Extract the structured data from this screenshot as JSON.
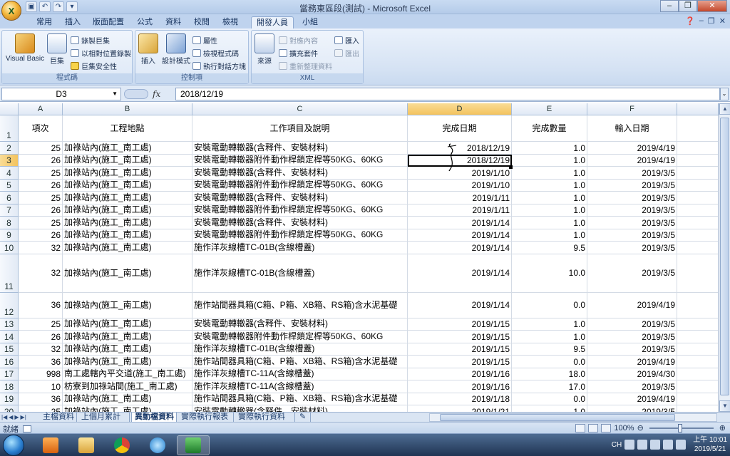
{
  "window": {
    "title": "當務東區段(測試) - Microsoft Excel",
    "minimize_icon": "minimize-icon",
    "maximize_icon": "restore-icon",
    "close_icon": "close-icon"
  },
  "ribbon": {
    "tabs": [
      "常用",
      "插入",
      "版面配置",
      "公式",
      "資料",
      "校閱",
      "檢視",
      "開發人員",
      "小組"
    ],
    "active_tab": "開發人員",
    "groups": {
      "code": {
        "label": "程式碼",
        "visual_basic": "Visual Basic",
        "macros": "巨集",
        "record_macro": "錄製巨集",
        "relative_ref": "以相對位置錄製",
        "macro_security": "巨集安全性"
      },
      "controls": {
        "label": "控制項",
        "insert": "插入",
        "design_mode": "設計模式",
        "properties": "屬性",
        "view_code": "檢視程式碼",
        "run_dialog": "執行對話方塊"
      },
      "xml": {
        "label": "XML",
        "source": "來源",
        "map_properties": "對應內容",
        "expansion_packs": "擴充套件",
        "refresh_data": "重新整理資料",
        "import": "匯入",
        "export": "匯出"
      }
    }
  },
  "formula_bar": {
    "name_box": "D3",
    "fx": "fx",
    "content": "2018/12/19"
  },
  "sheet": {
    "columns": [
      "A",
      "B",
      "C",
      "D",
      "E",
      "F"
    ],
    "selected_column": "D",
    "header_row": {
      "row_num": "1",
      "cells": [
        "項次",
        "工程地點",
        "工作項目及說明",
        "完成日期",
        "完成數量",
        "輸入日期"
      ]
    },
    "rows": [
      {
        "n": "2",
        "a": "25",
        "b": "加祿站內(施工_南工處)",
        "c": "安裝電動轉轍器(含释件、安裝材料)",
        "d": "2018/12/19",
        "e": "1.0",
        "f": "2019/4/19"
      },
      {
        "n": "3",
        "a": "26",
        "b": "加祿站內(施工_南工處)",
        "c": "安裝電動轉轍器附件動作桿鎖定桿等50KG、60KG",
        "d": "2018/12/19",
        "e": "1.0",
        "f": "2019/4/19"
      },
      {
        "n": "4",
        "a": "25",
        "b": "加祿站內(施工_南工處)",
        "c": "安裝電動轉轍器(含释件、安裝材料)",
        "d": "2019/1/10",
        "e": "1.0",
        "f": "2019/3/5"
      },
      {
        "n": "5",
        "a": "26",
        "b": "加祿站內(施工_南工處)",
        "c": "安裝電動轉轍器附件動作桿鎖定桿等50KG、60KG",
        "d": "2019/1/10",
        "e": "1.0",
        "f": "2019/3/5"
      },
      {
        "n": "6",
        "a": "25",
        "b": "加祿站內(施工_南工處)",
        "c": "安裝電動轉轍器(含释件、安裝材料)",
        "d": "2019/1/11",
        "e": "1.0",
        "f": "2019/3/5"
      },
      {
        "n": "7",
        "a": "26",
        "b": "加祿站內(施工_南工處)",
        "c": "安裝電動轉轍器附件動作桿鎖定桿等50KG、60KG",
        "d": "2019/1/11",
        "e": "1.0",
        "f": "2019/3/5"
      },
      {
        "n": "8",
        "a": "25",
        "b": "加祿站內(施工_南工處)",
        "c": "安裝電動轉轍器(含释件、安裝材料)",
        "d": "2019/1/14",
        "e": "1.0",
        "f": "2019/3/5"
      },
      {
        "n": "9",
        "a": "26",
        "b": "加祿站內(施工_南工處)",
        "c": "安裝電動轉轍器附件動作桿鎖定桿等50KG、60KG",
        "d": "2019/1/14",
        "e": "1.0",
        "f": "2019/3/5"
      },
      {
        "n": "10",
        "a": "32",
        "b": "加祿站內(施工_南工處)",
        "c": "施作洋灰線槽TC-01B(含線槽蓋)",
        "d": "2019/1/14",
        "e": "9.5",
        "f": "2019/3/5"
      },
      {
        "n": "11",
        "a": "32",
        "b": "加祿站內(施工_南工處)",
        "c": "施作洋灰線槽TC-01B(含線槽蓋)",
        "d": "2019/1/14",
        "e": "10.0",
        "f": "2019/3/5"
      },
      {
        "n": "12",
        "a": "36",
        "b": "加祿站內(施工_南工處)",
        "c": "施作站間器具箱(C箱、P箱、XB箱、RS箱)含水泥基礎",
        "d": "2019/1/14",
        "e": "0.0",
        "f": "2019/4/19"
      },
      {
        "n": "13",
        "a": "25",
        "b": "加祿站內(施工_南工處)",
        "c": "安裝電動轉轍器(含释件、安裝材料)",
        "d": "2019/1/15",
        "e": "1.0",
        "f": "2019/3/5"
      },
      {
        "n": "14",
        "a": "26",
        "b": "加祿站內(施工_南工處)",
        "c": "安裝電動轉轍器附件動作桿鎖定桿等50KG、60KG",
        "d": "2019/1/15",
        "e": "1.0",
        "f": "2019/3/5"
      },
      {
        "n": "15",
        "a": "32",
        "b": "加祿站內(施工_南工處)",
        "c": "施作洋灰線槽TC-01B(含線槽蓋)",
        "d": "2019/1/15",
        "e": "9.5",
        "f": "2019/3/5"
      },
      {
        "n": "16",
        "a": "36",
        "b": "加祿站內(施工_南工處)",
        "c": "施作站間器具箱(C箱、P箱、XB箱、RS箱)含水泥基礎",
        "d": "2019/1/15",
        "e": "0.0",
        "f": "2019/4/19"
      },
      {
        "n": "17",
        "a": "998",
        "b": "南工處轄內平交道(施工_南工處)",
        "c": "施作洋灰線槽TC-11A(含線槽蓋)",
        "d": "2019/1/16",
        "e": "18.0",
        "f": "2019/4/30"
      },
      {
        "n": "18",
        "a": "10",
        "b": "枋寮到加祿站間(施工_南工處)",
        "c": "施作洋灰線槽TC-11A(含線槽蓋)",
        "d": "2019/1/16",
        "e": "17.0",
        "f": "2019/3/5"
      },
      {
        "n": "19",
        "a": "36",
        "b": "加祿站內(施工_南工處)",
        "c": "施作站間器具箱(C箱、P箱、XB箱、RS箱)含水泥基礎",
        "d": "2019/1/18",
        "e": "0.0",
        "f": "2019/4/19"
      },
      {
        "n": "20",
        "a": "25",
        "b": "加祿站內(施工_南工處)",
        "c": "安裝電動轉轍器(含释件、安裝材料)",
        "d": "2019/1/21",
        "e": "1.0",
        "f": "2019/3/5"
      }
    ]
  },
  "sheet_tabs": [
    "主檔資料",
    "上個月累計",
    "異動檔資料",
    "實際執行報表",
    "實際執行資料"
  ],
  "active_sheet": "異動檔資料",
  "status": {
    "ready": "就緒",
    "zoom": "100%"
  },
  "taskbar": {
    "apps": [
      "media-player-icon",
      "file-explorer-icon",
      "chrome-icon",
      "internet-explorer-icon",
      "excel-icon"
    ],
    "ime": "CH",
    "clock_time": "上午 10:01",
    "clock_date": "2019/5/21"
  }
}
